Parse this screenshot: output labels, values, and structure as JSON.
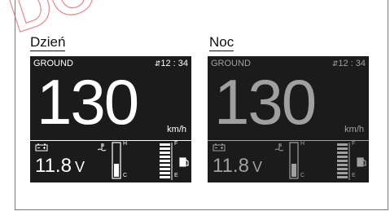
{
  "captions": {
    "day": "Dzień",
    "night": "Noc"
  },
  "day": {
    "mode": "GROUND",
    "clock": "12 : 34",
    "speed": "130",
    "speed_unit": "km/h",
    "voltage": "11.8",
    "voltage_unit": "V",
    "temp_high": "H",
    "temp_low": "C",
    "fuel_full": "F",
    "fuel_empty": "E",
    "fg_color": "#ffffff"
  },
  "night": {
    "mode": "GROUND",
    "clock": "12 : 34",
    "speed": "130",
    "speed_unit": "km/h",
    "voltage": "11.8",
    "voltage_unit": "V",
    "temp_high": "H",
    "temp_low": "C",
    "fuel_full": "F",
    "fuel_empty": "E",
    "fg_color": "#a0a0a0"
  }
}
